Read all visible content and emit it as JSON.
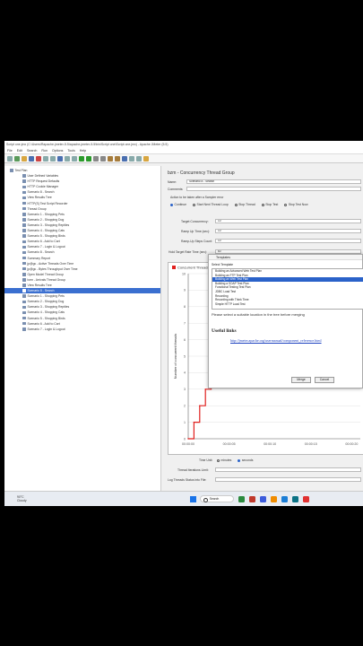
{
  "window": {
    "title": "Script one.jmx (C:\\Users\\Rapache-jmeter-5.5\\apache-jmeter-5.5\\bin\\Script one\\Script one.jmx) - Apache JMeter (5.5)"
  },
  "menu": [
    "File",
    "Edit",
    "Search",
    "Run",
    "Options",
    "Tools",
    "Help"
  ],
  "tree": [
    {
      "label": "Test Plan",
      "indent": 0
    },
    {
      "label": "User Defined Variables",
      "indent": 1
    },
    {
      "label": "HTTP Request Defaults",
      "indent": 1
    },
    {
      "label": "HTTP Cookie Manager",
      "indent": 1
    },
    {
      "label": "Scenario 8 - Search",
      "indent": 1
    },
    {
      "label": "View Results Tree",
      "indent": 1
    },
    {
      "label": "HTTP(S) Test Script Recorder",
      "indent": 1
    },
    {
      "label": "Thread Group",
      "indent": 1
    },
    {
      "label": "Scenario 1 - Shopping Pets",
      "indent": 1
    },
    {
      "label": "Scenario 2 - Shopping Dog",
      "indent": 1
    },
    {
      "label": "Scenario 3 - Shopping Reptiles",
      "indent": 1
    },
    {
      "label": "Scenario 4 - Shopping Cats",
      "indent": 1
    },
    {
      "label": "Scenario 5 - Shopping Birds",
      "indent": 1
    },
    {
      "label": "Scenario 6 - Add to Cart",
      "indent": 1
    },
    {
      "label": "Scenario 7 - Login & Logout",
      "indent": 1
    },
    {
      "label": "Scenario 8 - Search",
      "indent": 1
    },
    {
      "label": "Summary Report",
      "indent": 1
    },
    {
      "label": "jp@gc - Active Threads Over Time",
      "indent": 1
    },
    {
      "label": "jp@gc - Bytes Throughput Over Time",
      "indent": 1
    },
    {
      "label": "Open Model Thread Group",
      "indent": 1
    },
    {
      "label": "bzm - Arrivals Thread Group",
      "indent": 1
    },
    {
      "label": "View Results Tree",
      "indent": 1
    },
    {
      "label": "Scenario 8 - Search",
      "indent": 1,
      "selected": true
    },
    {
      "label": "Scenario 1 - Shopping Pets",
      "indent": 1
    },
    {
      "label": "Scenario 2 - Shopping Dog",
      "indent": 1
    },
    {
      "label": "Scenario 3 - Shopping Reptiles",
      "indent": 1
    },
    {
      "label": "Scenario 4 - Shopping Cats",
      "indent": 1
    },
    {
      "label": "Scenario 5 - Shopping Birds",
      "indent": 1
    },
    {
      "label": "Scenario 6 - Add to Cart",
      "indent": 1
    },
    {
      "label": "Scenario 7 - Login & Logout",
      "indent": 1
    }
  ],
  "panel": {
    "title": "bzm - Concurrency Thread Group",
    "name_label": "Name:",
    "name_value": "Scenario 8 - Search",
    "comments_label": "Comments:",
    "error_label": "Action to be taken after a Sampler error",
    "error_options": [
      "Continue",
      "Start Next Thread Loop",
      "Stop Thread",
      "Stop Test",
      "Stop Test Now"
    ],
    "target_label": "Target Concurrency:",
    "target_value": "10",
    "rampup_label": "Ramp Up Time (sec):",
    "rampup_value": "10",
    "steps_label": "Ramp-Up Steps Count:",
    "steps_value": "10",
    "hold_label": "Hold Target Rate Time (sec):",
    "hold_value": "60",
    "timeunit_label": "Time Unit:",
    "timeunit_minutes": "minutes",
    "timeunit_seconds": "seconds",
    "iterations_label": "Thread Iterations Limit:",
    "log_label": "Log Threads Status into File:"
  },
  "chart_data": {
    "type": "line",
    "series": [
      {
        "x": [
          0,
          1,
          2,
          3,
          4,
          5,
          6,
          7,
          8,
          9,
          10
        ],
        "y": [
          0,
          1,
          2,
          3,
          4,
          5,
          6,
          7,
          8,
          9,
          10
        ]
      }
    ],
    "xlabel": "",
    "ylabel": "Number of concurrent threads",
    "legend": "Concurrent Threads",
    "y_ticks": [
      "0",
      "1",
      "2",
      "3",
      "4",
      "5",
      "6",
      "7",
      "8",
      "9",
      "10"
    ],
    "x_ticks": [
      "00:00:00",
      "00:00:05",
      "00:00:10",
      "00:00:15",
      "00:00:20"
    ],
    "ylim": [
      0,
      10
    ],
    "color": "#e0201e"
  },
  "dialog": {
    "title": "Templates",
    "select_label": "Select Template",
    "items": [
      "Building an Advanced Web Test Plan",
      "Building an FTP Test Plan",
      "Building an Web Test Plan",
      "Building a SOAP Test Plan",
      "Functional Testing Test Plan",
      "JDBC Load Test",
      "Recording",
      "Recording with Think Time",
      "Simple HTTP Load Test"
    ],
    "selected_index": 2,
    "description": "Please select a suitable location in the tree before merging",
    "heading": "Useful links",
    "link": "http://jmeter.apache.org/usermanual/component_reference.html",
    "merge_label": "Merge",
    "cancel_label": "Cancel"
  },
  "taskbar": {
    "weather_temp": "90°C",
    "weather_desc": "Cloudy",
    "search": "Search"
  }
}
